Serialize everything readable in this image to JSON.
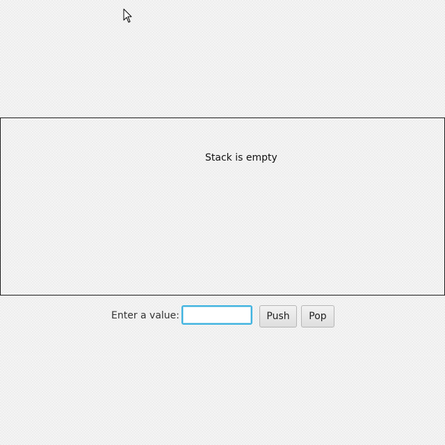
{
  "stack": {
    "status_text": "Stack is empty"
  },
  "controls": {
    "label": "Enter a value:",
    "input_value": "",
    "push_label": "Push",
    "pop_label": "Pop"
  },
  "colors": {
    "input_focus_border": "#3fb3e0",
    "pane_border": "#1a1a1a"
  },
  "icons": {
    "cursor": "mouse-pointer-icon"
  }
}
